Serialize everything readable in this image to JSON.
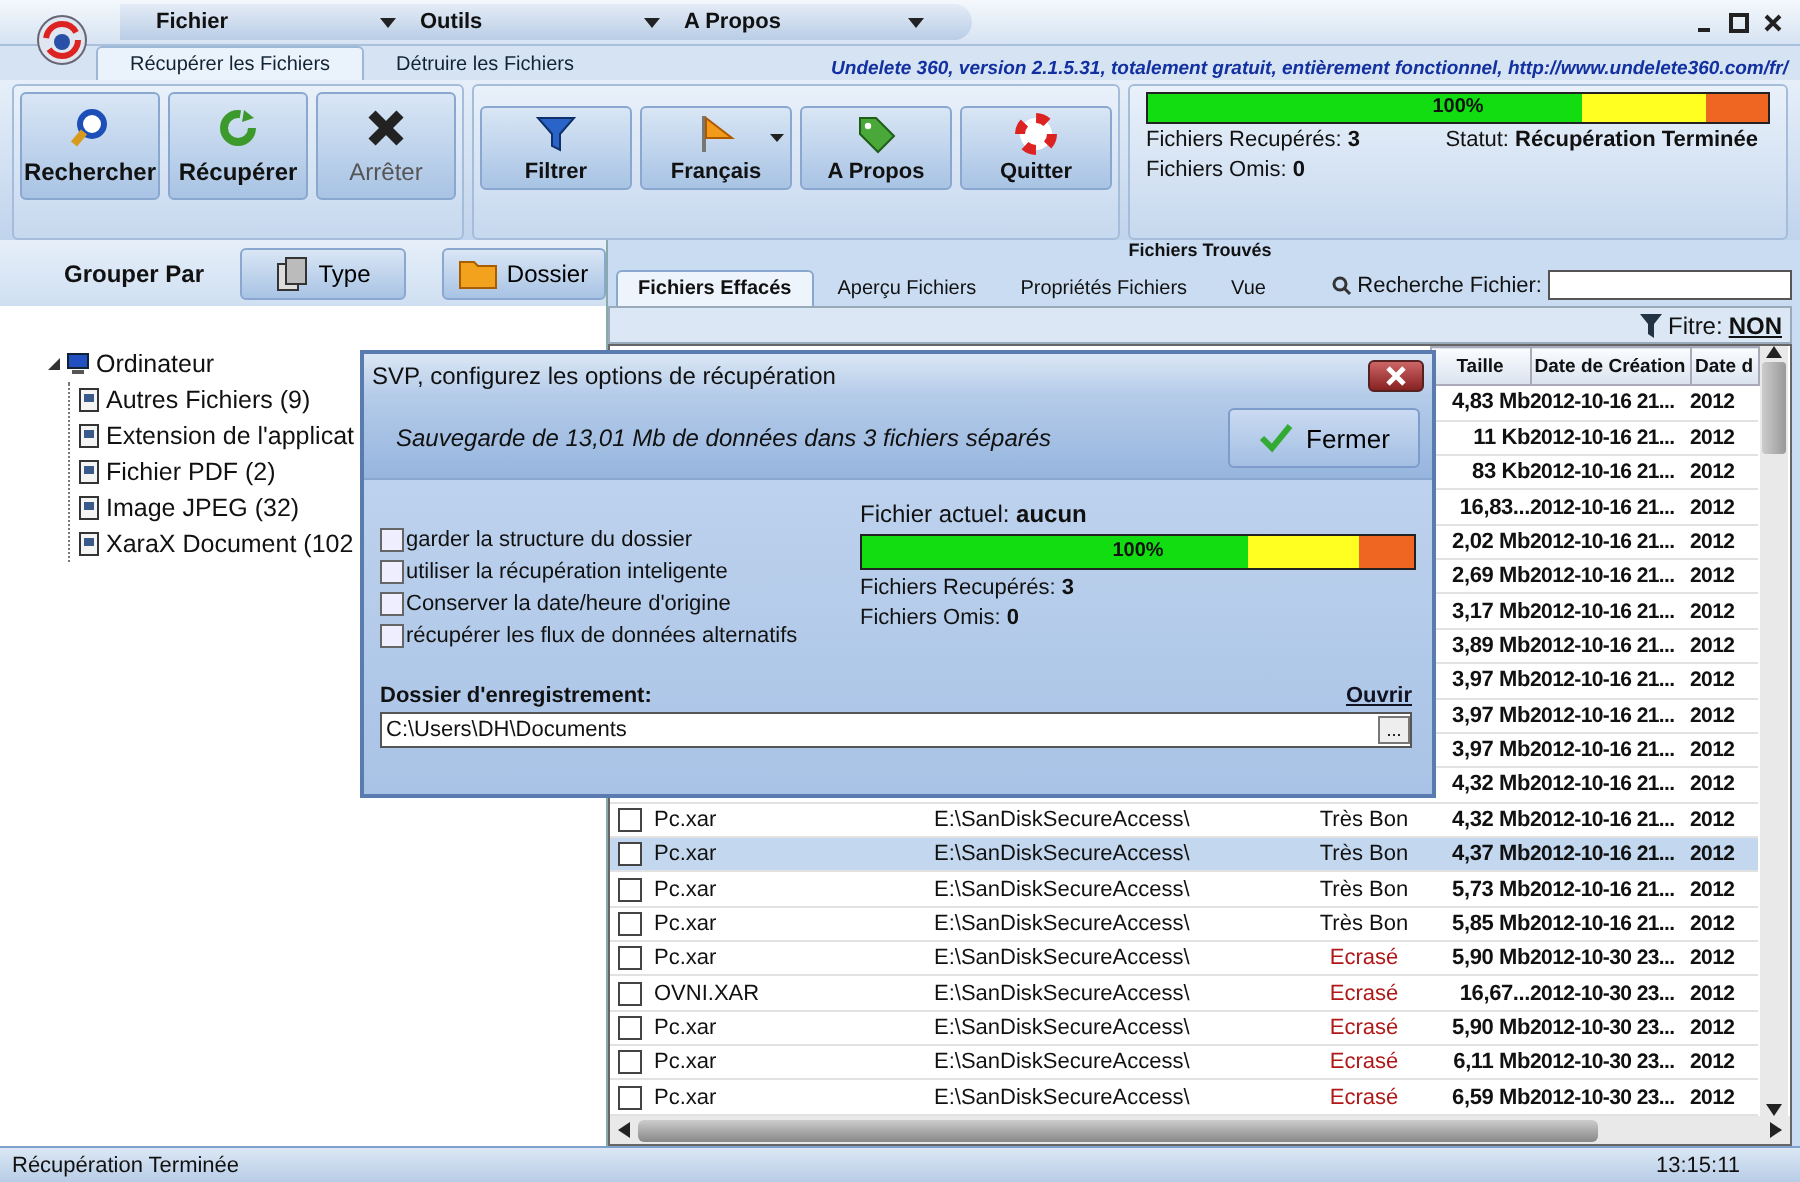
{
  "menu": [
    {
      "label": "Fichier"
    },
    {
      "label": "Outils"
    },
    {
      "label": "A Propos"
    }
  ],
  "tabs": [
    {
      "label": "Récupérer les Fichiers",
      "selected": true
    },
    {
      "label": "Détruire les Fichiers",
      "selected": false
    }
  ],
  "banner": "Undelete 360, version 2.1.5.31, totalement gratuit, entièrement fonctionnel, http://www.undelete360.com/fr/",
  "ribbon_actions": [
    {
      "label": "Rechercher",
      "disabled": false
    },
    {
      "label": "Récupérer",
      "disabled": false
    },
    {
      "label": "Arrêter",
      "disabled": true
    }
  ],
  "ribbon_tools": [
    {
      "label": "Filtrer",
      "dropdown": false
    },
    {
      "label": "Français",
      "dropdown": true
    },
    {
      "label": "A Propos",
      "dropdown": false
    },
    {
      "label": "Quitter",
      "dropdown": false
    }
  ],
  "progress": {
    "level": 1,
    "reading": "100%",
    "recovered": "Fichiers Recupérés: **3**",
    "skipped": "Fichiers Omis: **0**",
    "status": "Statut: **Récupération Terminée**"
  },
  "group_by": {
    "label": "Grouper Par",
    "buttons": [
      {
        "label": "Type"
      },
      {
        "label": "Dossier"
      }
    ]
  },
  "tree": [
    {
      "label": "Ordinateur",
      "expanded": true,
      "children": [
        {
          "label": "Autres Fichiers (9)"
        },
        {
          "label": "Extension de l'applicat"
        },
        {
          "label": "Fichier PDF (2)"
        },
        {
          "label": "Image JPEG (32)"
        },
        {
          "label": "XaraX Document (102"
        }
      ]
    }
  ],
  "files_panel": {
    "title": "Fichiers Trouvés",
    "tabs": [
      {
        "label": "Fichiers Effacés",
        "selected": true
      },
      {
        "label": "Aperçu Fichiers",
        "selected": false
      },
      {
        "label": "Propriétés Fichiers",
        "selected": false
      },
      {
        "label": "Vue",
        "selected": false
      }
    ],
    "search": {
      "label": "Recherche Fichier:"
    },
    "filter": {
      "label": "Fitre:",
      "value": "NON"
    },
    "columns": [
      "Taille",
      "Date de Création",
      "Date d"
    ],
    "rows": [
      {
        "size": "4,83 Mb",
        "created": "2012-10-16 21...",
        "date_3": "2012",
        "selected": false
      },
      {
        "size": "11 Kb",
        "created": "2012-10-16 21...",
        "date_3": "2012",
        "selected": false
      },
      {
        "size": "83 Kb",
        "created": "2012-10-16 21...",
        "date_3": "2012",
        "selected": false
      },
      {
        "size": "16,83...",
        "created": "2012-10-16 21...",
        "date_3": "2012",
        "selected": false
      },
      {
        "size": "2,02 Mb",
        "created": "2012-10-16 21...",
        "date_3": "2012",
        "selected": false
      },
      {
        "size": "2,69 Mb",
        "created": "2012-10-16 21...",
        "date_3": "2012",
        "selected": false
      },
      {
        "size": "3,17 Mb",
        "created": "2012-10-16 21...",
        "date_3": "2012",
        "selected": false
      },
      {
        "size": "3,89 Mb",
        "created": "2012-10-16 21...",
        "date_3": "2012",
        "selected": false
      },
      {
        "size": "3,97 Mb",
        "created": "2012-10-16 21...",
        "date_3": "2012",
        "selected": false
      },
      {
        "size": "3,97 Mb",
        "created": "2012-10-16 21...",
        "date_3": "2012",
        "selected": false
      },
      {
        "size": "3,97 Mb",
        "created": "2012-10-16 21...",
        "date_3": "2012",
        "selected": false
      },
      {
        "size": "4,32 Mb",
        "created": "2012-10-16 21...",
        "date_3": "2012",
        "selected": false
      },
      {
        "checked": false,
        "name": "Pc.xar",
        "path": "E:\\SanDiskSecureAccess\\",
        "state": "Très Bon",
        "kind": "good",
        "size": "4,32 Mb",
        "created": "2012-10-16 21...",
        "date_3": "2012",
        "selected": false
      },
      {
        "checked": false,
        "name": "Pc.xar",
        "path": "E:\\SanDiskSecureAccess\\",
        "state": "Très Bon",
        "kind": "good",
        "size": "4,37 Mb",
        "created": "2012-10-16 21...",
        "date_3": "2012",
        "selected": true
      },
      {
        "checked": false,
        "name": "Pc.xar",
        "path": "E:\\SanDiskSecureAccess\\",
        "state": "Très Bon",
        "kind": "good",
        "size": "5,73 Mb",
        "created": "2012-10-16 21...",
        "date_3": "2012",
        "selected": false
      },
      {
        "checked": false,
        "name": "Pc.xar",
        "path": "E:\\SanDiskSecureAccess\\",
        "state": "Très Bon",
        "kind": "good",
        "size": "5,85 Mb",
        "created": "2012-10-16 21...",
        "date_3": "2012",
        "selected": false
      },
      {
        "checked": false,
        "name": "Pc.xar",
        "path": "E:\\SanDiskSecureAccess\\",
        "state": "Ecrasé",
        "kind": "overwritten",
        "size": "5,90 Mb",
        "created": "2012-10-30 23...",
        "date_3": "2012",
        "selected": false
      },
      {
        "checked": false,
        "name": "OVNI.XAR",
        "path": "E:\\SanDiskSecureAccess\\",
        "state": "Ecrasé",
        "kind": "overwritten",
        "size": "16,67...",
        "created": "2012-10-30 23...",
        "date_3": "2012",
        "selected": false
      },
      {
        "checked": false,
        "name": "Pc.xar",
        "path": "E:\\SanDiskSecureAccess\\",
        "state": "Ecrasé",
        "kind": "overwritten",
        "size": "5,90 Mb",
        "created": "2012-10-30 23...",
        "date_3": "2012",
        "selected": false
      },
      {
        "checked": false,
        "name": "Pc.xar",
        "path": "E:\\SanDiskSecureAccess\\",
        "state": "Ecrasé",
        "kind": "overwritten",
        "size": "6,11 Mb",
        "created": "2012-10-30 23...",
        "date_3": "2012",
        "selected": false
      },
      {
        "checked": false,
        "name": "Pc.xar",
        "path": "E:\\SanDiskSecureAccess\\",
        "state": "Ecrasé",
        "kind": "overwritten",
        "size": "6,59 Mb",
        "created": "2012-10-30 23...",
        "date_3": "2012",
        "selected": false
      }
    ]
  },
  "dialog": {
    "title": "SVP, configurez les options de récupération",
    "message": "Sauvegarde de 13,01 Mb de données dans 3 fichiers séparés",
    "close_button": "Fermer",
    "options": [
      {
        "label": "garder la structure du dossier",
        "checked": false
      },
      {
        "label": "utiliser la récupération inteligente",
        "checked": false
      },
      {
        "label": "Conserver la date/heure d'origine",
        "checked": false
      },
      {
        "label": "récupérer les flux de données alternatifs",
        "checked": false
      }
    ],
    "current_file": "Fichier actuel: **aucun**",
    "progress": {
      "level": 1,
      "reading": "100%"
    },
    "recovered": "Fichiers Recupérés: **3**",
    "skipped": "Fichiers Omis: **0**",
    "folder_label": "Dossier d'enregistrement:",
    "open_link": "Ouvrir",
    "folder": "C:\\Users\\DH\\Documents",
    "browse": "..."
  },
  "status_bar": {
    "message": "Récupération Terminée",
    "time": "13:15:11"
  }
}
